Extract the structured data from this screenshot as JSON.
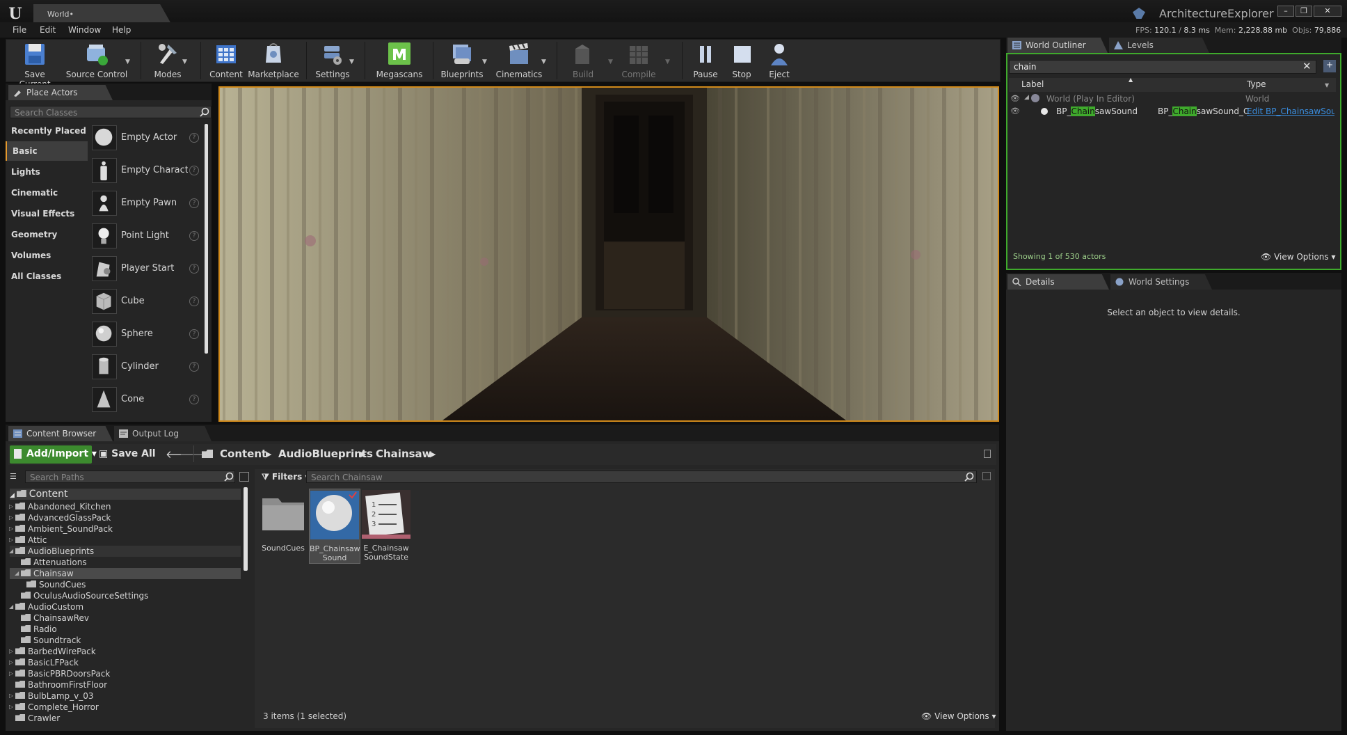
{
  "window": {
    "tab_title": "World",
    "project_name": "ArchitectureExplorer",
    "controls": [
      "–",
      "❐",
      "✕"
    ]
  },
  "menu": [
    "File",
    "Edit",
    "Window",
    "Help"
  ],
  "stats": {
    "fps_label": "FPS:",
    "fps": "120.1",
    "ms": "8.3 ms",
    "mem_label": "Mem:",
    "mem": "2,228.88 mb",
    "objs_label": "Objs:",
    "objs": "79,886"
  },
  "toolbar": [
    {
      "label": "Save Current",
      "icon": "save-icon"
    },
    {
      "label": "Source Control",
      "icon": "source-control-icon"
    },
    {
      "label": "Modes",
      "icon": "modes-icon"
    },
    {
      "label": "Content",
      "icon": "content-icon"
    },
    {
      "label": "Marketplace",
      "icon": "marketplace-icon"
    },
    {
      "label": "Settings",
      "icon": "settings-icon"
    },
    {
      "label": "Megascans",
      "icon": "megascans-icon"
    },
    {
      "label": "Blueprints",
      "icon": "blueprints-icon"
    },
    {
      "label": "Cinematics",
      "icon": "cinematics-icon"
    },
    {
      "label": "Build",
      "icon": "build-icon"
    },
    {
      "label": "Compile",
      "icon": "compile-icon"
    },
    {
      "label": "Pause",
      "icon": "pause-icon"
    },
    {
      "label": "Stop",
      "icon": "stop-icon"
    },
    {
      "label": "Eject",
      "icon": "eject-icon"
    }
  ],
  "place_actors": {
    "tab": "Place Actors",
    "search_placeholder": "Search Classes",
    "categories": [
      "Recently Placed",
      "Basic",
      "Lights",
      "Cinematic",
      "Visual Effects",
      "Geometry",
      "Volumes",
      "All Classes"
    ],
    "active_category": "Basic",
    "actors": [
      "Empty Actor",
      "Empty Characte",
      "Empty Pawn",
      "Point Light",
      "Player Start",
      "Cube",
      "Sphere",
      "Cylinder",
      "Cone"
    ]
  },
  "outliner": {
    "tabs": [
      "World Outliner",
      "Levels"
    ],
    "search_value": "chain",
    "col_label": "Label",
    "col_type": "Type",
    "rows": [
      {
        "label": "World (Play In Editor)",
        "type": "World"
      },
      {
        "label_pre": "BP_",
        "label_hl": "Chain",
        "label_post": "sawSound",
        "type_pre": "BP_",
        "type_hl": "Chain",
        "type_post": "sawSound_C",
        "link": "Edit BP_ChainsawSour"
      }
    ],
    "status": "Showing 1 of 530 actors",
    "view_options": "View Options"
  },
  "details": {
    "tabs": [
      "Details",
      "World Settings"
    ],
    "message": "Select an object to view details."
  },
  "content_browser": {
    "tabs": [
      "Content Browser",
      "Output Log"
    ],
    "add_import": "Add/Import",
    "save_all": "Save All",
    "breadcrumb": [
      "Content",
      "AudioBlueprints",
      "Chainsaw"
    ],
    "search_paths_placeholder": "Search Paths",
    "filters": "Filters",
    "search_assets_placeholder": "Search Chainsaw",
    "tree_root": "Content",
    "tree": [
      {
        "label": "Abandoned_Kitchen",
        "depth": 1
      },
      {
        "label": "AdvancedGlassPack",
        "depth": 1
      },
      {
        "label": "Ambient_SoundPack",
        "depth": 1
      },
      {
        "label": "Attic",
        "depth": 1
      },
      {
        "label": "AudioBlueprints",
        "depth": 1
      },
      {
        "label": "Attenuations",
        "depth": 2
      },
      {
        "label": "Chainsaw",
        "depth": 2
      },
      {
        "label": "SoundCues",
        "depth": 3
      },
      {
        "label": "OculusAudioSourceSettings",
        "depth": 2
      },
      {
        "label": "AudioCustom",
        "depth": 1
      },
      {
        "label": "ChainsawRev",
        "depth": 2
      },
      {
        "label": "Radio",
        "depth": 2
      },
      {
        "label": "Soundtrack",
        "depth": 2
      },
      {
        "label": "BarbedWirePack",
        "depth": 1
      },
      {
        "label": "BasicLFPack",
        "depth": 1
      },
      {
        "label": "BasicPBRDoorsPack",
        "depth": 1
      },
      {
        "label": "BathroomFirstFloor",
        "depth": 1
      },
      {
        "label": "BulbLamp_v_03",
        "depth": 1
      },
      {
        "label": "Complete_Horror",
        "depth": 1
      },
      {
        "label": "Crawler",
        "depth": 1
      }
    ],
    "assets": [
      {
        "line1": "SoundCues",
        "line2": ""
      },
      {
        "line1": "BP_Chainsaw",
        "line2": "Sound"
      },
      {
        "line1": "E_Chainsaw",
        "line2": "SoundState"
      }
    ],
    "item_count": "3 items (1 selected)",
    "view_options": "View Options"
  },
  "colors": {
    "accent_orange": "#d18a1b",
    "highlight_green": "#3faa2c",
    "link_blue": "#3a8dde",
    "selection_blue": "#3369a6"
  }
}
